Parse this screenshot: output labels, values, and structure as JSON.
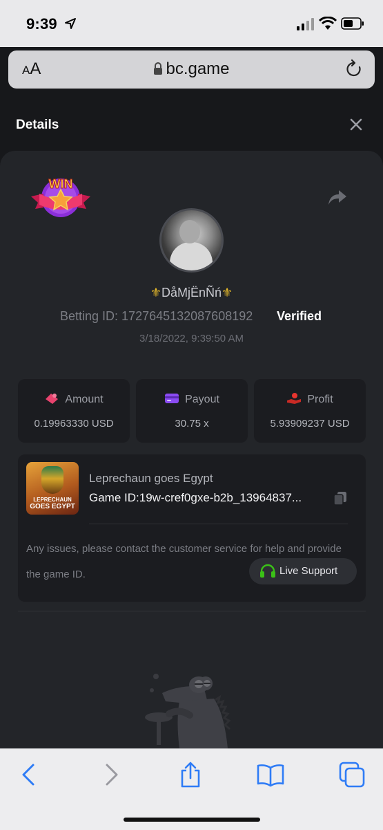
{
  "status_bar": {
    "time": "9:39"
  },
  "browser": {
    "aa_label_small": "A",
    "aa_label_large": "A",
    "url": "bc.game"
  },
  "details": {
    "title": "Details",
    "badge_text": "WIN",
    "username": "⚜️DåMjËnÑń⚜️",
    "username_core": "DåMjËnÑń",
    "betting_id": "Betting ID: 1727645132087608192",
    "verified_label": "Verified",
    "timestamp": "3/18/2022, 9:39:50 AM"
  },
  "stats": [
    {
      "label": "Amount",
      "value": "0.19963330 USD",
      "icon": "amount-icon",
      "icon_color": "#e8436e"
    },
    {
      "label": "Payout",
      "value": "30.75 x",
      "icon": "payout-card-icon",
      "icon_color": "#8a4bf2"
    },
    {
      "label": "Profit",
      "value": "5.93909237 USD",
      "icon": "profit-hand-icon",
      "icon_color": "#e8352f"
    }
  ],
  "game": {
    "name": "Leprechaun goes Egypt",
    "thumb_caption_1": "LEPRECHAUN",
    "thumb_caption_2": "GOES EGYPT",
    "game_id": "Game ID:19w-cref0gxe-b2b_13964837..."
  },
  "support": {
    "issue_text": "Any issues, please contact the customer service for help and provide the game ID.",
    "button_label": "Live Support",
    "accent_color": "#3bc117"
  },
  "colors": {
    "card_bg": "#232529",
    "panel_bg": "#1b1c20",
    "page_bg": "#17181b",
    "ios_blue": "#2f7cf6"
  }
}
